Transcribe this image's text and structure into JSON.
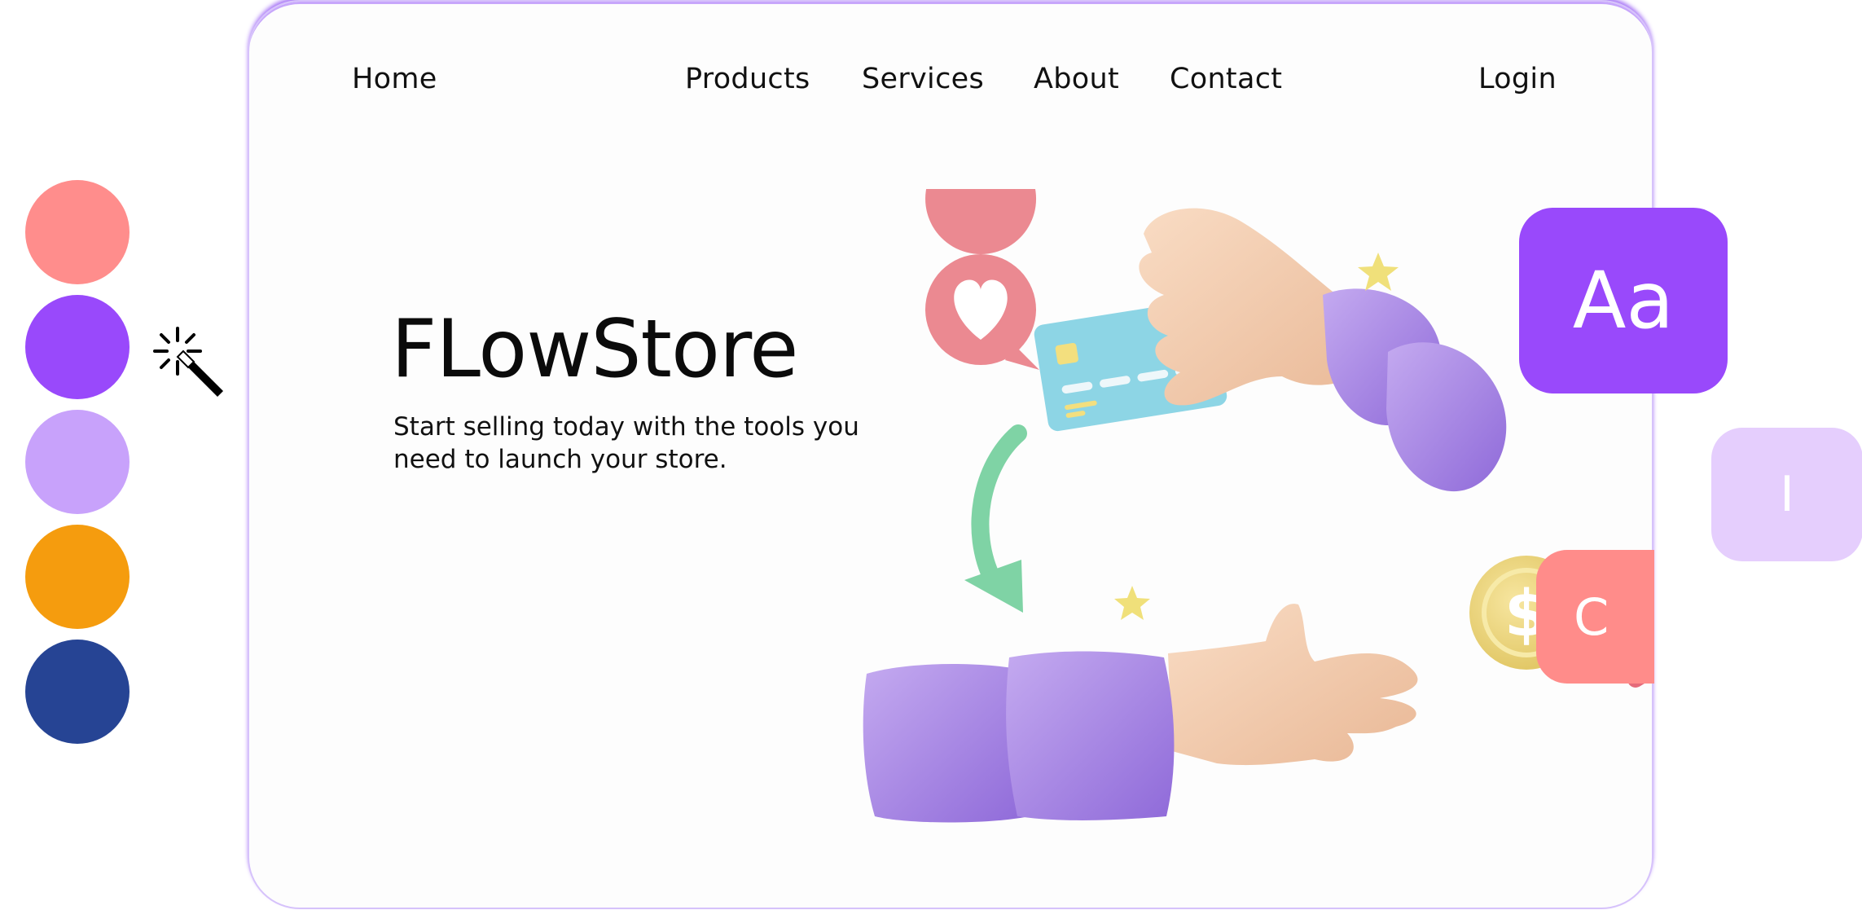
{
  "palette": {
    "swatches": [
      "#ff8d8c",
      "#9949fb",
      "#c8a2fb",
      "#f59c0e",
      "#264494"
    ],
    "tool_icon": "magic-wand-icon"
  },
  "nav": {
    "home": "Home",
    "products": "Products",
    "services": "Services",
    "about": "About",
    "contact": "Contact",
    "login": "Login"
  },
  "hero": {
    "title": "FLowStore",
    "subtitle": "Start selling today with the tools you need to launch your store.",
    "illustration_icons": [
      "heart-chat-bubble-icon",
      "credit-card-icon",
      "coin-dollar-icon",
      "hands-exchange-icon",
      "arrow-icon",
      "star-icon"
    ],
    "coin_symbol": "$"
  },
  "type_chips": {
    "aa": "Aa",
    "i": "I",
    "c": "C"
  },
  "colors": {
    "accent": "#9949fb",
    "card_border": "#c7a6fb"
  }
}
